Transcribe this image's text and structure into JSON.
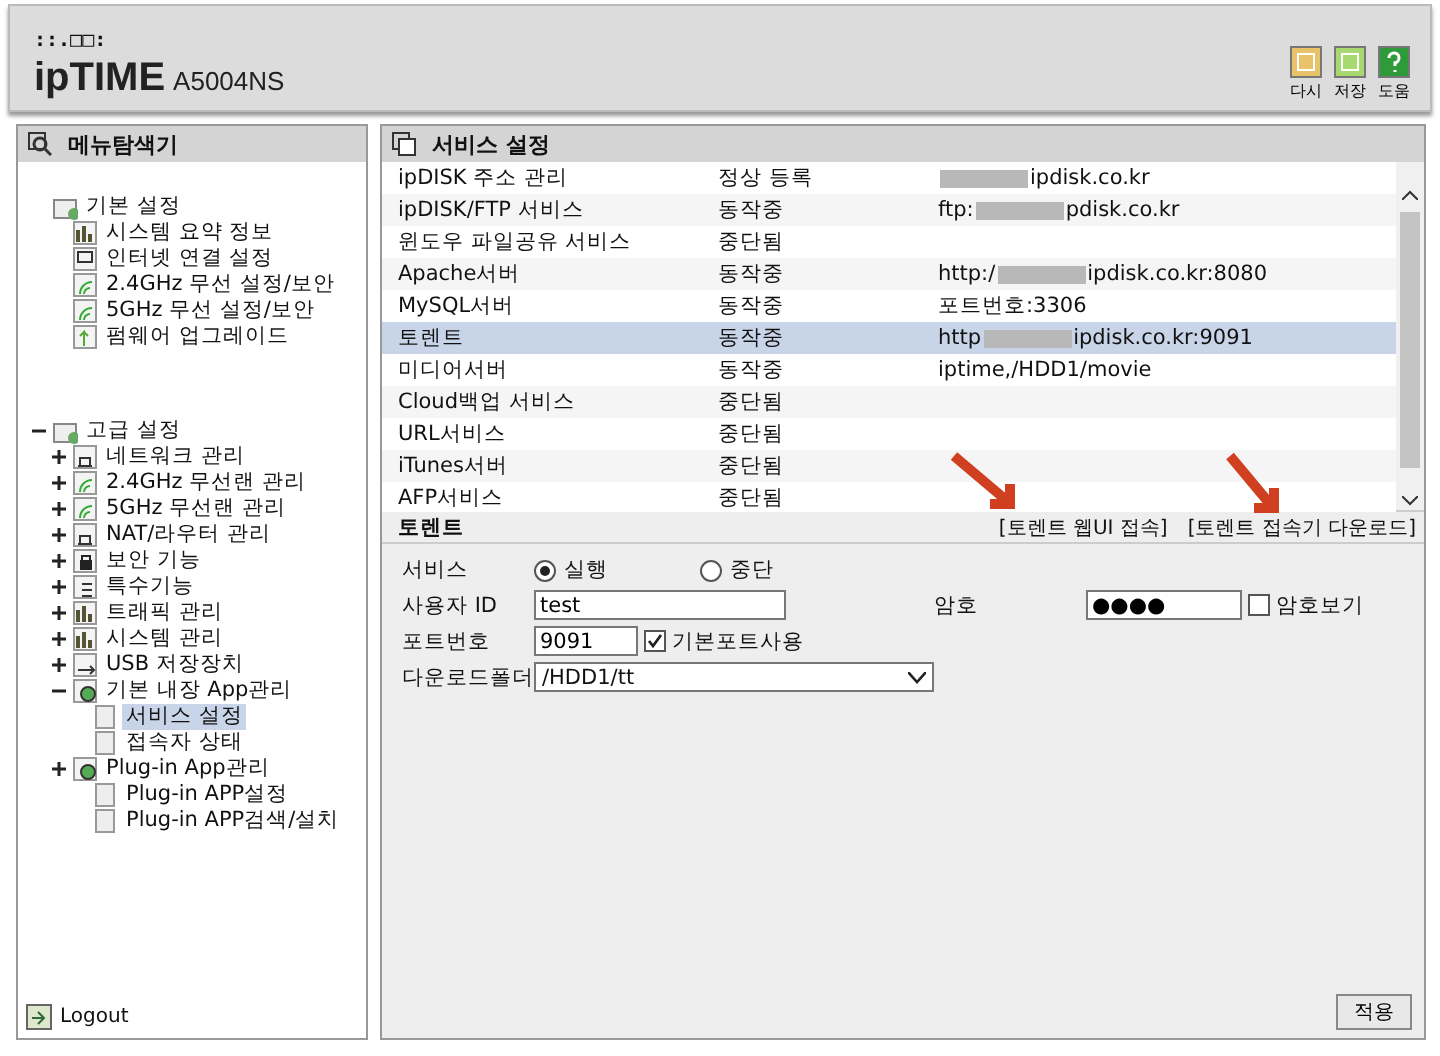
{
  "header": {
    "brand_small": "::.□□:",
    "brand": "ipTIME",
    "model": "A5004NS",
    "actions": [
      {
        "kind": "reload",
        "label": "다시"
      },
      {
        "kind": "save",
        "label": "저장"
      },
      {
        "kind": "help",
        "label": "도움"
      }
    ]
  },
  "sidebar": {
    "title": "메뉴탐색기",
    "tree": [
      {
        "label": "기본 설정",
        "kind": "folder",
        "selected": false,
        "children": [
          {
            "label": "시스템 요약 정보",
            "kind": "chart",
            "selected": false
          },
          {
            "label": "인터넷 연결 설정",
            "kind": "monitor",
            "selected": false
          },
          {
            "label": "2.4GHz 무선 설정/보안",
            "kind": "wifi",
            "selected": false
          },
          {
            "label": "5GHz 무선 설정/보안",
            "kind": "wifi",
            "selected": false
          },
          {
            "label": "펌웨어 업그레이드",
            "kind": "upgrade",
            "selected": false
          }
        ]
      },
      {
        "label": "고급 설정",
        "kind": "folder",
        "expanded": true,
        "selected": false,
        "children": [
          {
            "label": "네트워크 관리",
            "kind": "network",
            "expanded": false,
            "selected": false
          },
          {
            "label": "2.4GHz 무선랜 관리",
            "kind": "wifi",
            "expanded": false,
            "selected": false
          },
          {
            "label": "5GHz 무선랜 관리",
            "kind": "wifi",
            "expanded": false,
            "selected": false
          },
          {
            "label": "NAT/라우터 관리",
            "kind": "network",
            "expanded": false,
            "selected": false
          },
          {
            "label": "보안 기능",
            "kind": "lock",
            "expanded": false,
            "selected": false
          },
          {
            "label": "특수기능",
            "kind": "doc",
            "expanded": false,
            "selected": false
          },
          {
            "label": "트래픽 관리",
            "kind": "chart",
            "expanded": false,
            "selected": false
          },
          {
            "label": "시스템 관리",
            "kind": "chart",
            "expanded": false,
            "selected": false
          },
          {
            "label": "USB 저장장치",
            "kind": "usb",
            "expanded": false,
            "selected": false
          },
          {
            "label": "기본 내장 App관리",
            "kind": "app",
            "expanded": true,
            "selected": false,
            "children": [
              {
                "label": "서비스 설정",
                "kind": "page",
                "selected": true
              },
              {
                "label": "접속자 상태",
                "kind": "page",
                "selected": false
              }
            ]
          },
          {
            "label": "Plug-in App관리",
            "kind": "app",
            "expanded": false,
            "selected": false,
            "children": [
              {
                "label": "Plug-in APP설정",
                "kind": "page",
                "selected": false
              },
              {
                "label": "Plug-in APP검색/설치",
                "kind": "page",
                "selected": false
              }
            ]
          }
        ]
      }
    ],
    "logout": "Logout"
  },
  "services": {
    "title": "서비스 설정",
    "rows": [
      {
        "name": "ipDISK 주소 관리",
        "status": "정상 등록",
        "info": "ipdisk.co.kr",
        "masked": true,
        "selected": false
      },
      {
        "name": "ipDISK/FTP 서비스",
        "status": "동작중",
        "info": "ftp:",
        "info_tail": "pdisk.co.kr",
        "masked": true,
        "selected": false
      },
      {
        "name": "윈도우 파일공유 서비스",
        "status": "중단됨",
        "selected": false
      },
      {
        "name": "Apache서버",
        "status": "동작중",
        "info": "http:/",
        "info_tail": "ipdisk.co.kr:8080",
        "masked": true,
        "selected": false
      },
      {
        "name": "MySQL서버",
        "status": "동작중",
        "info": "포트번호:3306",
        "selected": false
      },
      {
        "name": "토렌트",
        "status": "동작중",
        "info": "http",
        "info_tail": "ipdisk.co.kr:9091",
        "masked": true,
        "selected": true
      },
      {
        "name": "미디어서버",
        "status": "동작중",
        "info": "iptime,/HDD1/movie",
        "selected": false
      },
      {
        "name": "Cloud백업 서비스",
        "status": "중단됨",
        "selected": false
      },
      {
        "name": "URL서비스",
        "status": "중단됨",
        "selected": false
      },
      {
        "name": "iTunes서버",
        "status": "중단됨",
        "selected": false
      },
      {
        "name": "AFP서비스",
        "status": "중단됨",
        "selected": false
      }
    ]
  },
  "torrent": {
    "title": "토렌트",
    "links": [
      "[토렌트 웹UI 접속]",
      "[토렌트 접속기 다운로드]"
    ],
    "service_label": "서비스",
    "radios": [
      {
        "label": "실행",
        "selected": true
      },
      {
        "label": "중단",
        "selected": false
      }
    ],
    "user_label": "사용자 ID",
    "user_value": "test",
    "password_label": "암호",
    "password_value": "●●●●",
    "show_password": {
      "label": "암호보기",
      "checked": false
    },
    "port_label": "포트번호",
    "port_value": "9091",
    "default_port": {
      "label": "기본포트사용",
      "checked": true
    },
    "folder_label": "다운로드폴더",
    "folder_value": "/HDD1/tt"
  },
  "apply_button": "적용"
}
